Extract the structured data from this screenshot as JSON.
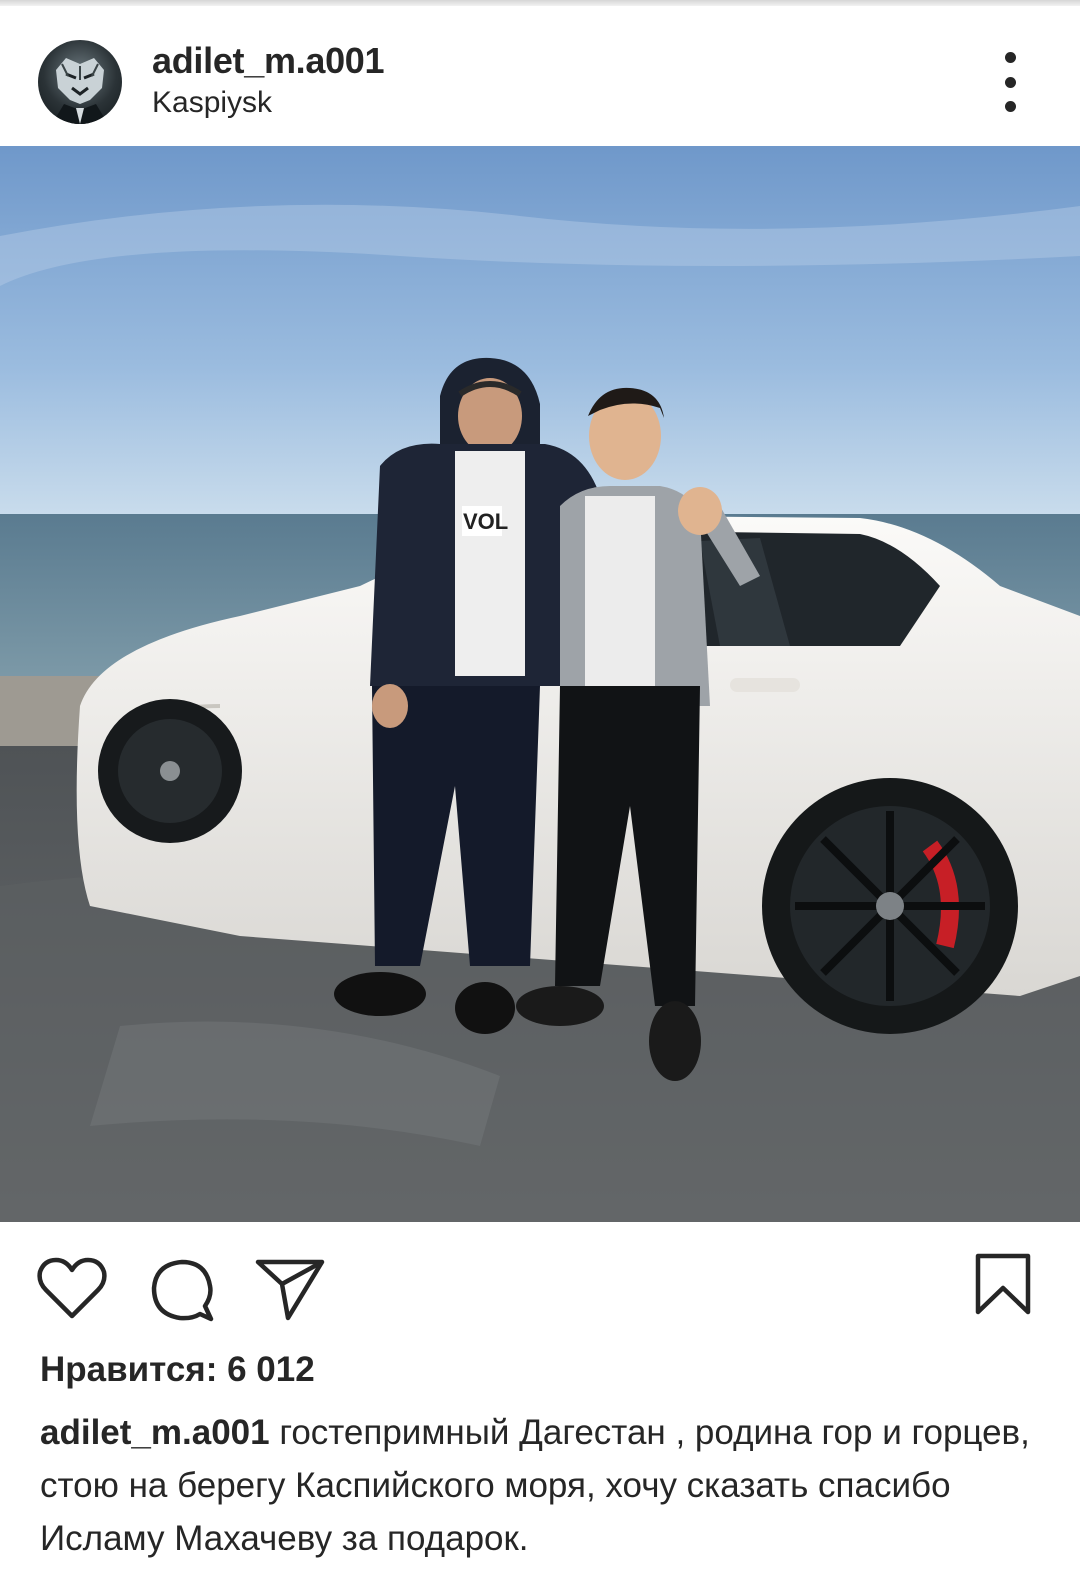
{
  "post": {
    "username": "adilet_m.a001",
    "location": "Kaspiysk",
    "photo_badges": [
      "VOL"
    ],
    "likes_text": "Нравится: 6 012",
    "caption_user": "adilet_m.a001",
    "caption_text": " гостепримный Дагестан , родина гор и горцев,  стою на берегу Каспийского моря, хочу сказать спасибо Исламу Махачеву за подарок."
  },
  "icons": {
    "more": "more-vertical-icon",
    "tag": "user-tag-icon",
    "like": "heart-icon",
    "comment": "comment-icon",
    "share": "share-icon",
    "save": "bookmark-icon"
  },
  "colors": {
    "text": "#262626",
    "sky_top": "#7fa6d4",
    "sea": "#5b7f93",
    "car": "#f3f1ee"
  }
}
